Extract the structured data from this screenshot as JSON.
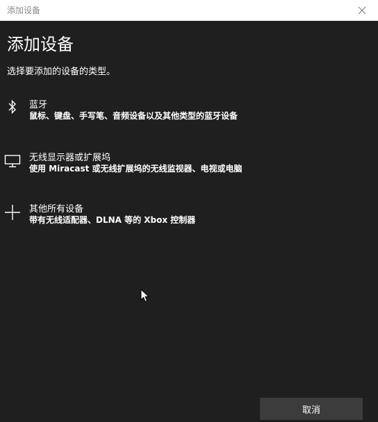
{
  "window": {
    "title": "添加设备",
    "close_icon": "close-icon"
  },
  "main": {
    "heading": "添加设备",
    "subtitle": "选择要添加的设备的类型。"
  },
  "options": [
    {
      "icon": "bluetooth-icon",
      "name": "蓝牙",
      "description": "鼠标、键盘、手写笔、音频设备以及其他类型的蓝牙设备"
    },
    {
      "icon": "monitor-icon",
      "name": "无线显示器或扩展坞",
      "description": "使用 Miracast 或无线扩展坞的无线监视器、电视或电脑"
    },
    {
      "icon": "plus-icon",
      "name": "其他所有设备",
      "description": "带有无线适配器、DLNA 等的 Xbox 控制器"
    }
  ],
  "footer": {
    "cancel_label": "取消"
  },
  "colors": {
    "background": "#1f1f1f",
    "titlebar": "#ffffff",
    "button": "#3c3c3c",
    "text": "#ffffff"
  }
}
